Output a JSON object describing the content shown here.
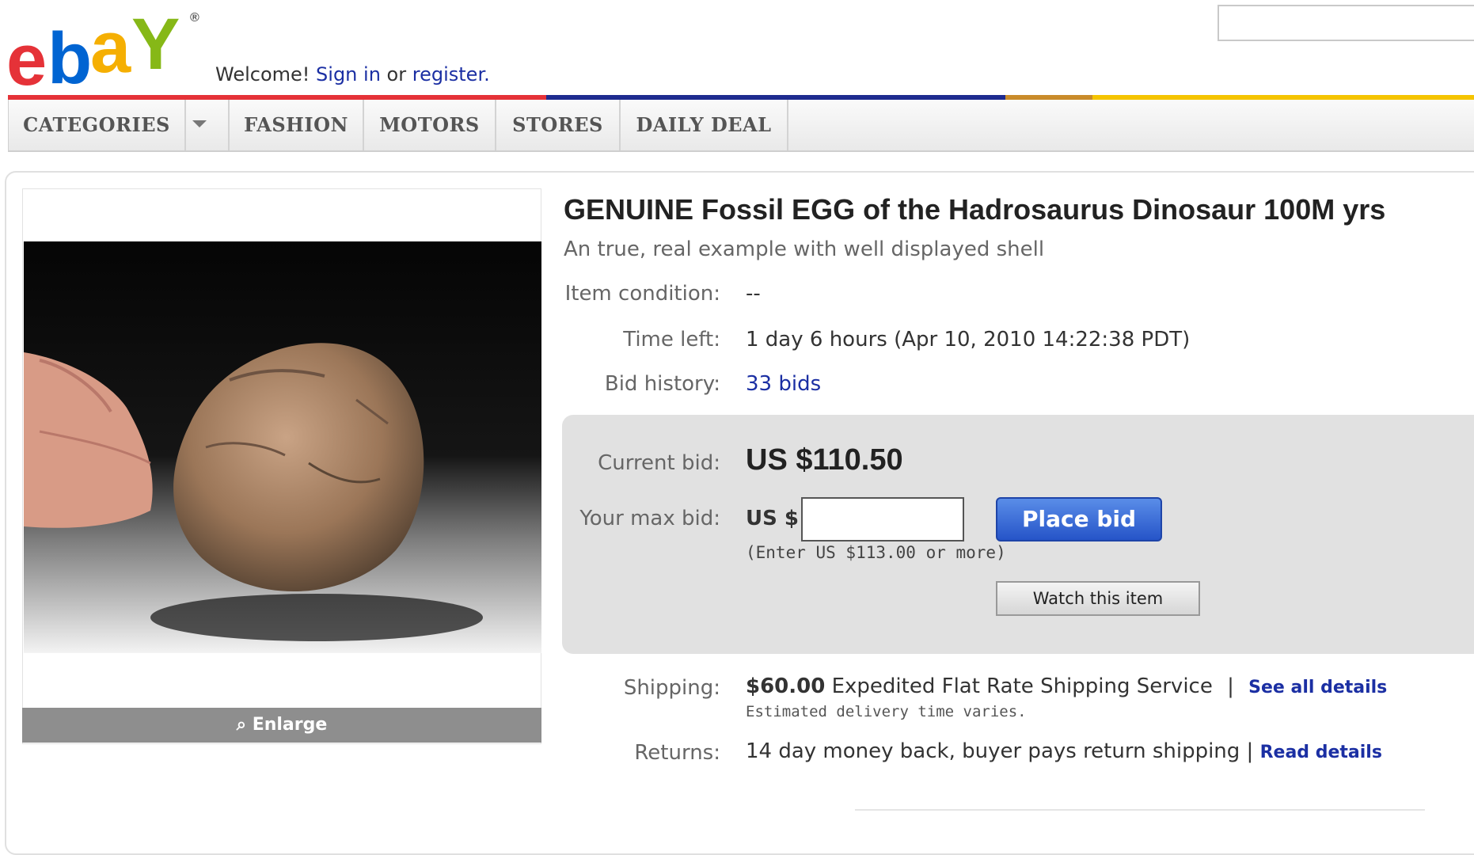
{
  "header": {
    "welcome_text": "Welcome!",
    "sign_in": "Sign in",
    "or_text": "or",
    "register": "register.",
    "brand_colors": [
      "#e53238",
      "#0064d2",
      "#f5af02",
      "#86b817"
    ]
  },
  "nav": {
    "categories": "CATEGORIES",
    "fashion": "FASHION",
    "motors": "MOTORS",
    "stores": "STORES",
    "daily_deal": "DAILY DEAL"
  },
  "gallery": {
    "enlarge_label": "Enlarge",
    "enlarge_icon": "magnifier-icon"
  },
  "item": {
    "title": "GENUINE Fossil EGG of the Hadrosaurus Dinosaur 100M yrs",
    "subtitle": "An true, real example with well displayed shell",
    "condition_label": "Item condition:",
    "condition_value": "--",
    "time_left_label": "Time left:",
    "time_left_value": "1 day 6 hours (Apr 10, 2010 14:22:38 PDT)",
    "bid_history_label": "Bid history:",
    "bid_history_value": "33 bids"
  },
  "bid": {
    "current_label": "Current bid:",
    "current_value": "US $110.50",
    "max_label": "Your max bid:",
    "currency_prefix": "US $",
    "input_value": "",
    "hint": "(Enter US $113.00 or more)",
    "place_bid": "Place bid",
    "watch": "Watch this item"
  },
  "shipping": {
    "label": "Shipping:",
    "cost": "$60.00",
    "service": "Expedited Flat Rate Shipping Service",
    "separator": "|",
    "details_link": "See all details",
    "note": "Estimated delivery time varies."
  },
  "returns": {
    "label": "Returns:",
    "policy": "14 day money back, buyer pays return shipping |",
    "details_link": "Read details"
  }
}
